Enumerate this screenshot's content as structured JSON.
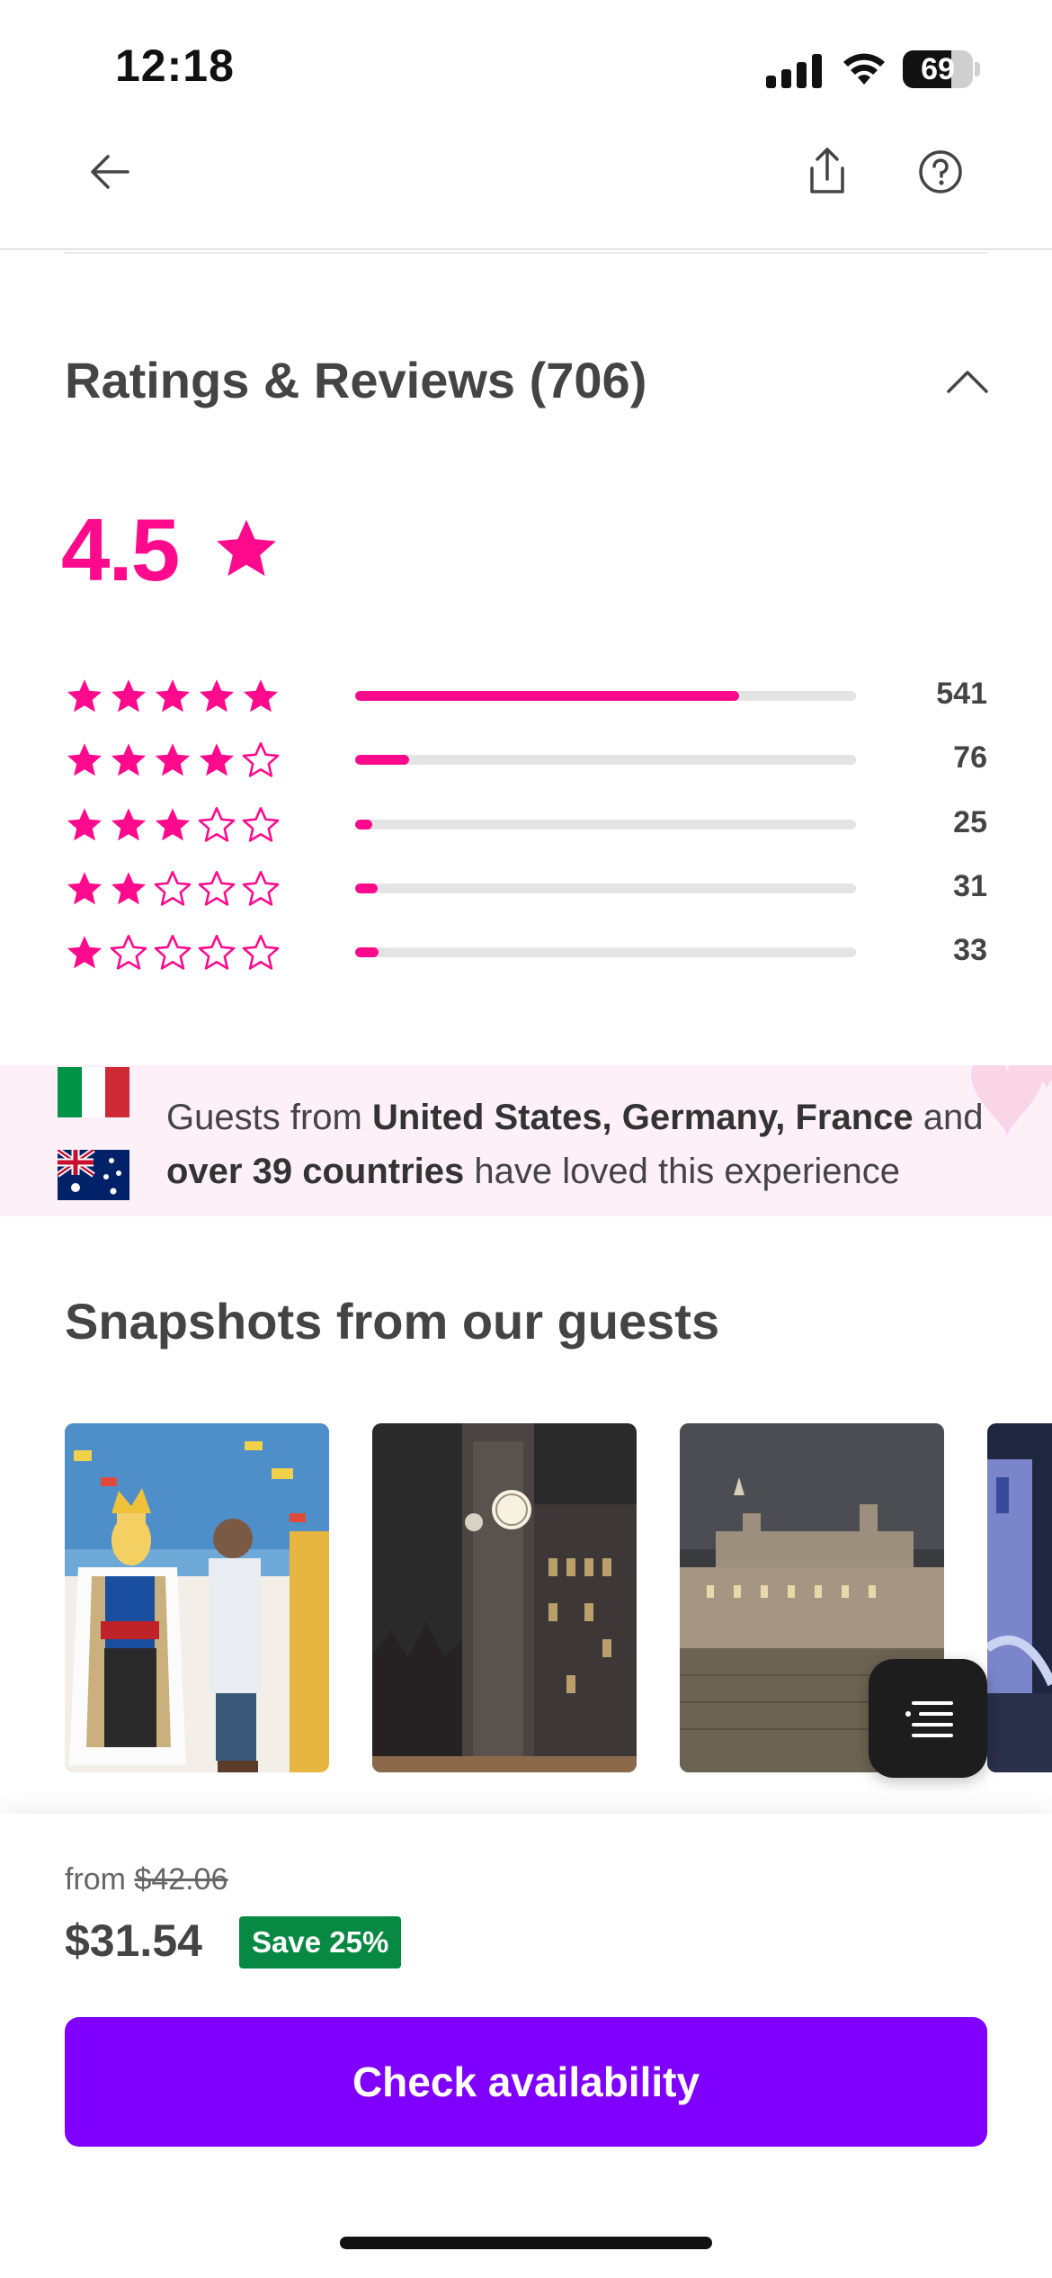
{
  "status_bar": {
    "time": "12:18",
    "battery": "69",
    "battery_level": 0.69
  },
  "nav": {
    "back_icon": "arrow-left-icon",
    "share_icon": "share-icon",
    "help_icon": "question-circle-icon"
  },
  "ratings": {
    "title": "Ratings & Reviews (706)",
    "average": "4.5",
    "accent_color": "#ff0a8c",
    "rows": [
      {
        "stars": 5,
        "count": "541",
        "fraction": 0.766
      },
      {
        "stars": 4,
        "count": "76",
        "fraction": 0.108
      },
      {
        "stars": 3,
        "count": "25",
        "fraction": 0.035
      },
      {
        "stars": 2,
        "count": "31",
        "fraction": 0.044
      },
      {
        "stars": 1,
        "count": "33",
        "fraction": 0.047
      }
    ]
  },
  "guests_banner": {
    "prefix": "Guests from ",
    "countries": "United States, Germany, France",
    "middle": " and ",
    "more": "over 39 countries",
    "suffix": " have loved this experience",
    "flags": [
      "italy-flag",
      "australia-flag"
    ]
  },
  "snapshots": {
    "title": "Snapshots from our guests",
    "images": [
      "lego-king-photo",
      "big-ben-night-photo",
      "tower-of-london-night-photo",
      "tower-bridge-photo"
    ]
  },
  "booking": {
    "from_label": "from",
    "original_price": "$42.06",
    "price": "$31.54",
    "save_badge": "Save 25%",
    "save_color": "#088943",
    "cta_label": "Check availability",
    "cta_color": "#8000ff"
  }
}
